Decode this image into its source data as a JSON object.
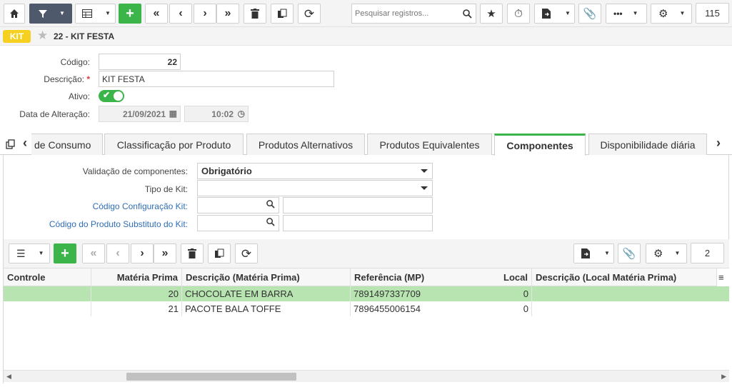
{
  "toolbar": {
    "search_placeholder": "Pesquisar registros...",
    "record_count": "115"
  },
  "header": {
    "badge": "KIT",
    "title": "22 - KIT FESTA"
  },
  "form": {
    "codigo_label": "Código:",
    "codigo_value": "22",
    "descricao_label": "Descrição:",
    "required_mark": "*",
    "descricao_value": "KIT FESTA",
    "ativo_label": "Ativo:",
    "ativo_on": true,
    "data_alteracao_label": "Data de Alteração:",
    "data_value": "21/09/2021",
    "hora_value": "10:02"
  },
  "tabs": [
    {
      "label": "de Consumo"
    },
    {
      "label": "Classificação por Produto"
    },
    {
      "label": "Produtos Alternativos"
    },
    {
      "label": "Produtos Equivalentes"
    },
    {
      "label": "Componentes",
      "active": true
    },
    {
      "label": "Disponibilidade diária"
    }
  ],
  "componentes": {
    "validacao_label": "Validação de componentes:",
    "validacao_value": "Obrigatório",
    "tipo_kit_label": "Tipo de Kit:",
    "tipo_kit_value": "",
    "cod_config_label": "Código Configuração Kit:",
    "cod_substituto_label": "Código do Produto Substituto do Kit:"
  },
  "grid": {
    "record_count": "2",
    "columns": [
      "Controle",
      "Matéria Prima",
      "Descrição (Matéria Prima)",
      "Referência (MP)",
      "Local",
      "Descrição (Local Matéria Prima)"
    ],
    "rows": [
      {
        "controle": "",
        "materia_prima": "20",
        "descricao": "CHOCOLATE EM BARRA",
        "referencia": "7891497337709",
        "local": "0",
        "descricao_local": ""
      },
      {
        "controle": "",
        "materia_prima": "21",
        "descricao": "PACOTE BALA TOFFE",
        "referencia": "7896455006154",
        "local": "0",
        "descricao_local": ""
      }
    ]
  },
  "colors": {
    "accent_green": "#3bb54a",
    "badge_yellow": "#f5d020",
    "link_blue": "#2f6db5",
    "selected_row": "#b7e4b0"
  }
}
